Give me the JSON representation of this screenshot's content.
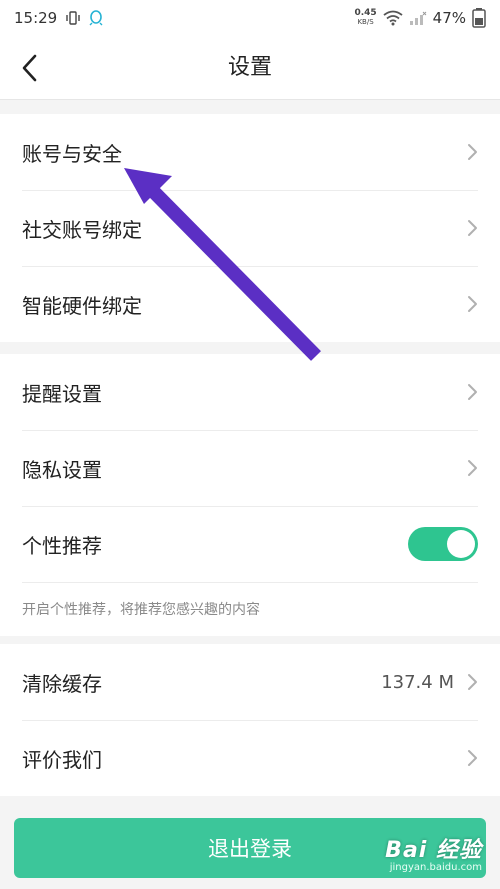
{
  "status_bar": {
    "time": "15:29",
    "net_speed_value": "0.45",
    "net_speed_unit": "KB/S",
    "battery": "47%"
  },
  "header": {
    "title": "设置",
    "back_icon": "chevron-left-icon"
  },
  "groups": {
    "account": [
      {
        "label": "账号与安全"
      },
      {
        "label": "社交账号绑定"
      },
      {
        "label": "智能硬件绑定"
      }
    ],
    "privacy": [
      {
        "label": "提醒设置"
      },
      {
        "label": "隐私设置"
      },
      {
        "label": "个性推荐"
      }
    ],
    "personalized_hint": "开启个性推荐，将推荐您感兴趣的内容",
    "storage": [
      {
        "label": "清除缓存",
        "value": "137.4 M"
      },
      {
        "label": "评价我们"
      }
    ]
  },
  "toggle_personalized": {
    "state": "on",
    "color": "#2ec590"
  },
  "logout_label": "退出登录",
  "watermark": {
    "brand": "Bai 经验",
    "url": "jingyan.baidu.com"
  },
  "colors": {
    "accent": "#3cc69a",
    "annotation_arrow": "#5b2fc4"
  }
}
